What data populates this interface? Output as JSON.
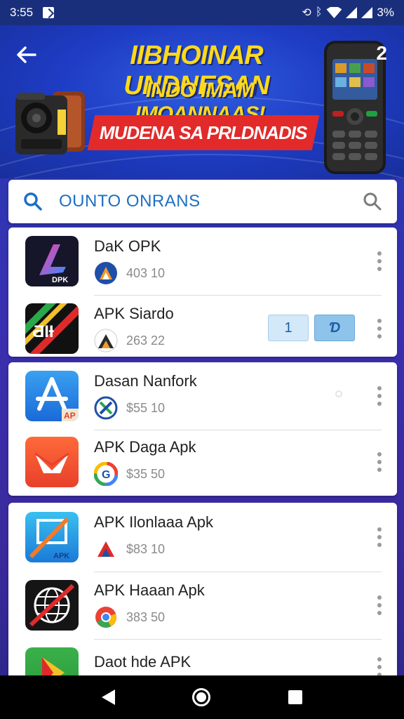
{
  "status_bar": {
    "time": "3:55",
    "battery": "3%"
  },
  "banner": {
    "page_number": "2",
    "title": "IIBHOINAR UNDNESAN",
    "subtitle": "INDO IMAM IMOANNAAS!",
    "ribbon": "MUDENA SA PRLDNADIS"
  },
  "search": {
    "placeholder": "OUNTO ONRANS"
  },
  "groups": [
    {
      "apps": [
        {
          "name": "DaK OPK",
          "size": "403 10",
          "icon": "apk-purple-logo-icon",
          "meta_icon": "apk-triangle-icon",
          "menu": true
        },
        {
          "name": "APK Siardo",
          "size": "263 22",
          "icon": "apk-stripe-logo-icon",
          "meta_icon": "apk-dark-triangle-icon",
          "menu": true,
          "chips": [
            "1",
            "Ɗ"
          ]
        }
      ]
    },
    {
      "apps": [
        {
          "name": "Dasan Nanfork",
          "size": "$55 10",
          "icon": "app-store-icon",
          "meta_icon": "apk-x-icon",
          "menu": true
        },
        {
          "name": "APK Daga Apk",
          "size": "$35 50",
          "icon": "mail-arrow-icon",
          "meta_icon": "google-g-icon",
          "menu": true
        }
      ]
    },
    {
      "apps": [
        {
          "name": "APK Ilonlaaa Apk",
          "size": "$83 10",
          "icon": "apk-blue-frame-icon",
          "meta_icon": "apk-red-triangle-icon",
          "menu": true
        },
        {
          "name": "APK Haaan Apk",
          "size": "383 50",
          "icon": "globe-slash-icon",
          "meta_icon": "chrome-icon",
          "menu": true
        },
        {
          "name": "Daot hde APK",
          "size": "",
          "icon": "green-play-icon",
          "meta_icon": "",
          "menu": true
        }
      ]
    }
  ],
  "colors": {
    "accent_blue": "#1e6fc4",
    "banner_yellow": "#ffd91a",
    "ribbon_red": "#e22a2a"
  }
}
